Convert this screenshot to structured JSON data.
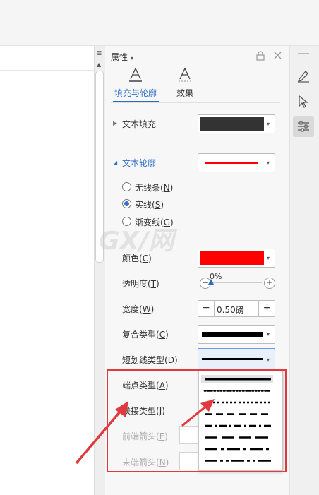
{
  "panel": {
    "title": "属性",
    "tabs": [
      {
        "label": "填充与轮廓",
        "active": true
      },
      {
        "label": "效果",
        "active": false
      }
    ]
  },
  "text_fill": {
    "label": "文本填充",
    "color": "#333333"
  },
  "text_outline": {
    "label": "文本轮廓",
    "color": "#ff0000",
    "options": [
      {
        "text": "无线条(",
        "key": "N",
        "close": ")",
        "selected": false
      },
      {
        "text": "实线(",
        "key": "S",
        "close": ")",
        "selected": true
      },
      {
        "text": "渐变线(",
        "key": "G",
        "close": ")",
        "selected": false
      }
    ]
  },
  "props": {
    "color": {
      "text": "颜色(",
      "key": "C",
      "close": ")",
      "value": "#ff0000"
    },
    "transparency": {
      "text": "透明度(",
      "key": "T",
      "close": ")",
      "value_label": "0%",
      "value": 0
    },
    "width": {
      "text": "宽度(",
      "key": "W",
      "close": ")",
      "value": "0.50磅",
      "minus": "−",
      "plus": "+"
    },
    "compound": {
      "text": "复合类型(",
      "key": "C",
      "close": ")"
    },
    "dash": {
      "text": "短划线类型(",
      "key": "D",
      "close": ")"
    },
    "cap": {
      "text": "端点类型(",
      "key": "A",
      "close": ")"
    },
    "join": {
      "text": "联接类型(",
      "key": "J",
      "close": ")"
    },
    "begin_arrow": {
      "text": "前端箭头(",
      "key": "E",
      "close": ")"
    },
    "end_arrow": {
      "text": "末端箭头(",
      "key": "N",
      "close": ")"
    }
  },
  "dash_menu": {
    "styles": [
      "solid",
      "round-dot",
      "square-dot",
      "dash",
      "dash-dot",
      "long-dash",
      "long-dash-dot",
      "long-dash-dot-dot"
    ]
  },
  "annotation": {
    "color": "#e0393e"
  },
  "watermark": {
    "text": "GX/网"
  }
}
